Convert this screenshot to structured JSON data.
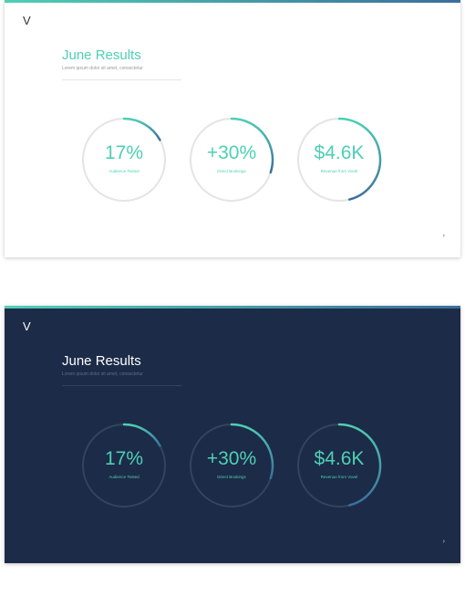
{
  "slides": [
    {
      "theme": "light",
      "logo": "V",
      "title": "June Results",
      "subtitle": "Lorem ipsum dolor sit amet, consectetur",
      "next_icon": "chevron-right-icon",
      "next_glyph": "›",
      "stats": [
        {
          "value": "17%",
          "label": "Audience Tested",
          "progress": 0.17
        },
        {
          "value": "+30%",
          "label": "Direct Bookings",
          "progress": 0.3
        },
        {
          "value": "$4.6K",
          "label": "Revenue from Vovel",
          "progress": 0.46
        }
      ]
    },
    {
      "theme": "dark",
      "logo": "V",
      "title": "June Results",
      "subtitle": "Lorem ipsum dolor sit amet, consectetur",
      "next_icon": "chevron-right-icon",
      "next_glyph": "›",
      "stats": [
        {
          "value": "17%",
          "label": "Audience Tested",
          "progress": 0.17
        },
        {
          "value": "+30%",
          "label": "Direct Bookings",
          "progress": 0.3
        },
        {
          "value": "$4.6K",
          "label": "Revenue from Vovel",
          "progress": 0.46
        }
      ]
    }
  ],
  "colors": {
    "accent_teal": "#4fcfb4",
    "accent_blue": "#3b6e9c",
    "light_bg": "#ffffff",
    "light_ring": "#e4e4e4",
    "light_title": "#4fcfb4",
    "light_text": "#999999",
    "dark_bg": "#1c2b47",
    "dark_ring": "#33445f",
    "dark_title": "#ffffff",
    "dark_text": "#5f6f8a"
  }
}
